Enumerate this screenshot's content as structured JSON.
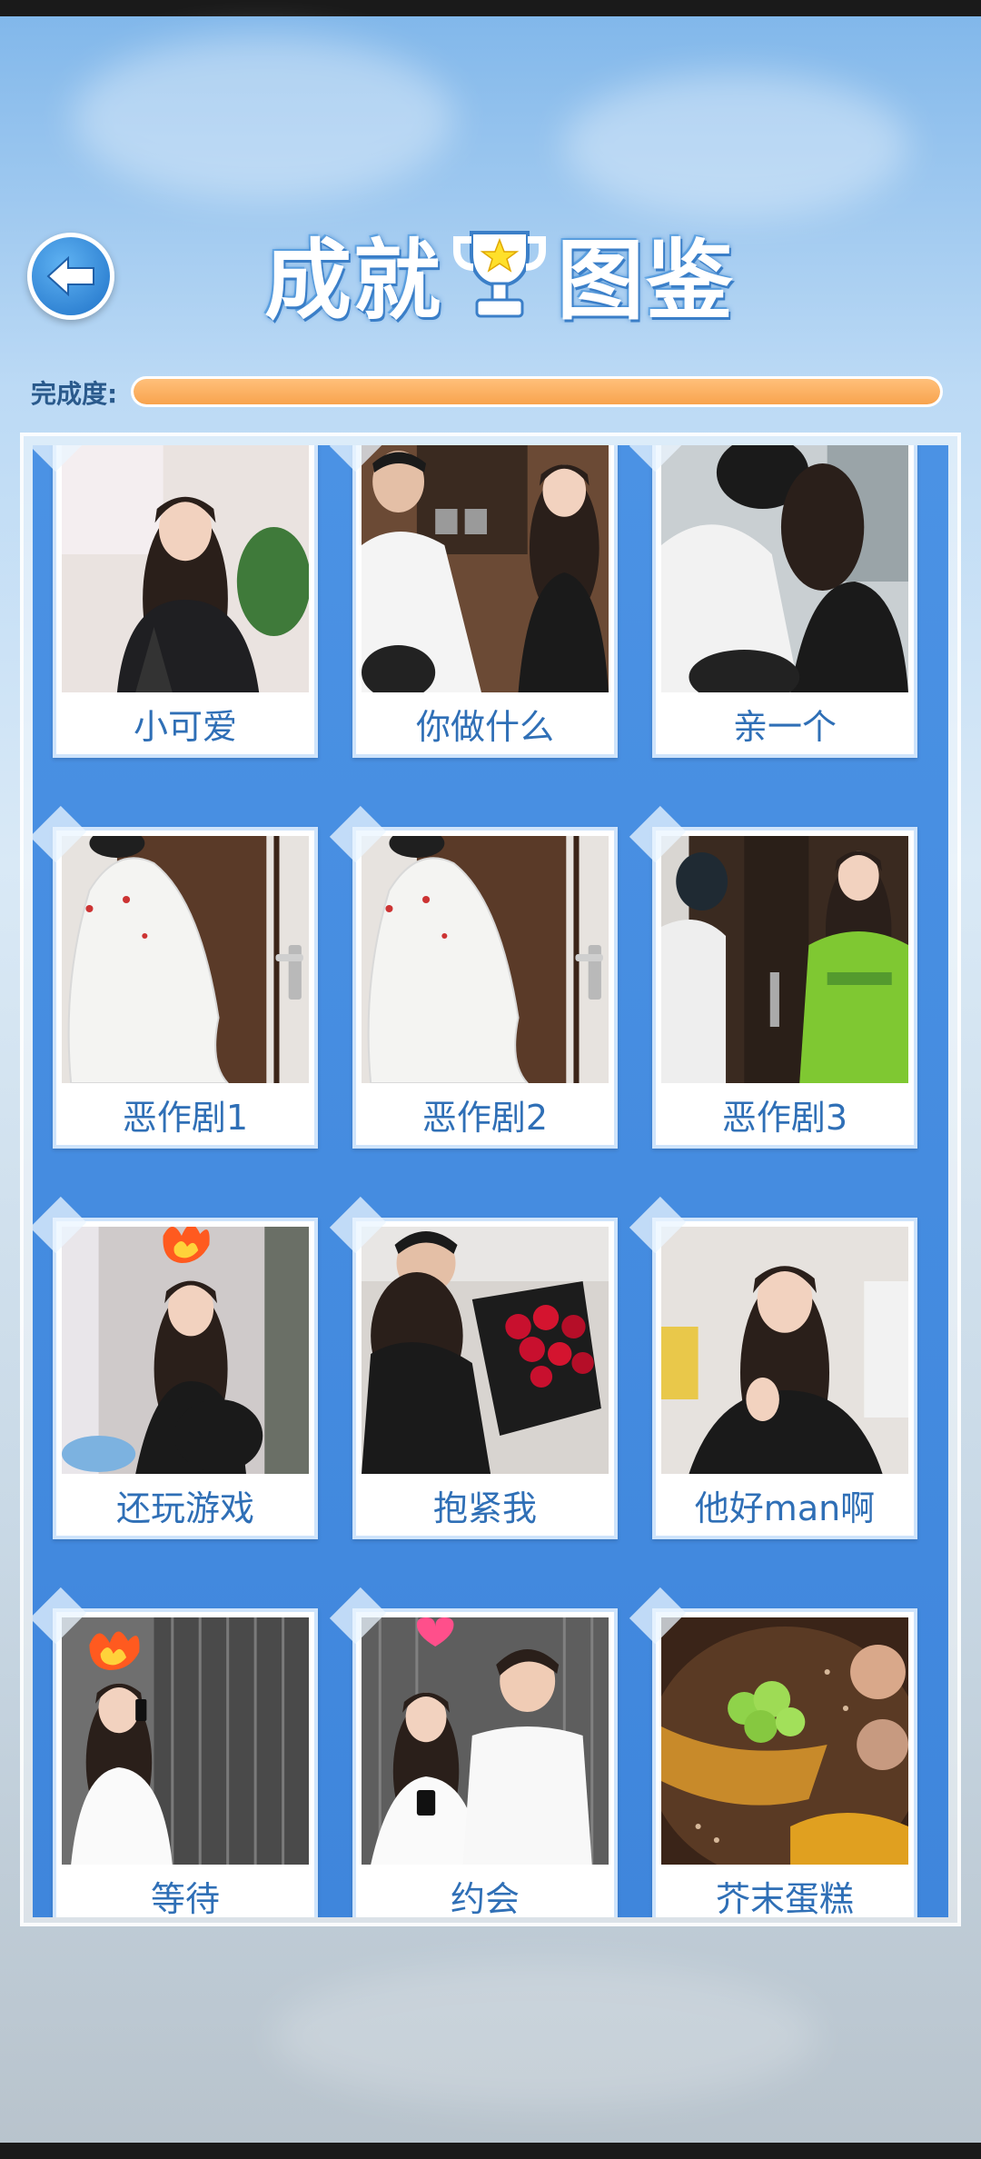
{
  "header": {
    "back_icon": "arrow-left-icon",
    "title_left": "成就",
    "title_right": "图鉴",
    "trophy_icon": "trophy-star-icon"
  },
  "progress": {
    "label": "完成度:",
    "value": 1.0,
    "fill_color": "#f8a44e"
  },
  "achievements": [
    {
      "label": "小可爱",
      "scene": "girl-portrait-indoor"
    },
    {
      "label": "你做什么",
      "scene": "couple-kitchen"
    },
    {
      "label": "亲一个",
      "scene": "kiss"
    },
    {
      "label": "恶作剧1",
      "scene": "sheet-ghost-door"
    },
    {
      "label": "恶作剧2",
      "scene": "sheet-ghost-door"
    },
    {
      "label": "恶作剧3",
      "scene": "masked-man-door"
    },
    {
      "label": "还玩游戏",
      "scene": "angry-girl-fire"
    },
    {
      "label": "抱紧我",
      "scene": "hug-roses"
    },
    {
      "label": "他好man啊",
      "scene": "shy-girl"
    },
    {
      "label": "等待",
      "scene": "girl-phone-fire"
    },
    {
      "label": "约会",
      "scene": "couple-date-heart"
    },
    {
      "label": "芥末蛋糕",
      "scene": "dessert"
    }
  ],
  "colors": {
    "accent_blue": "#3f86dc",
    "caption_text": "#2f6fb6",
    "progress_orange": "#f8a44e"
  }
}
